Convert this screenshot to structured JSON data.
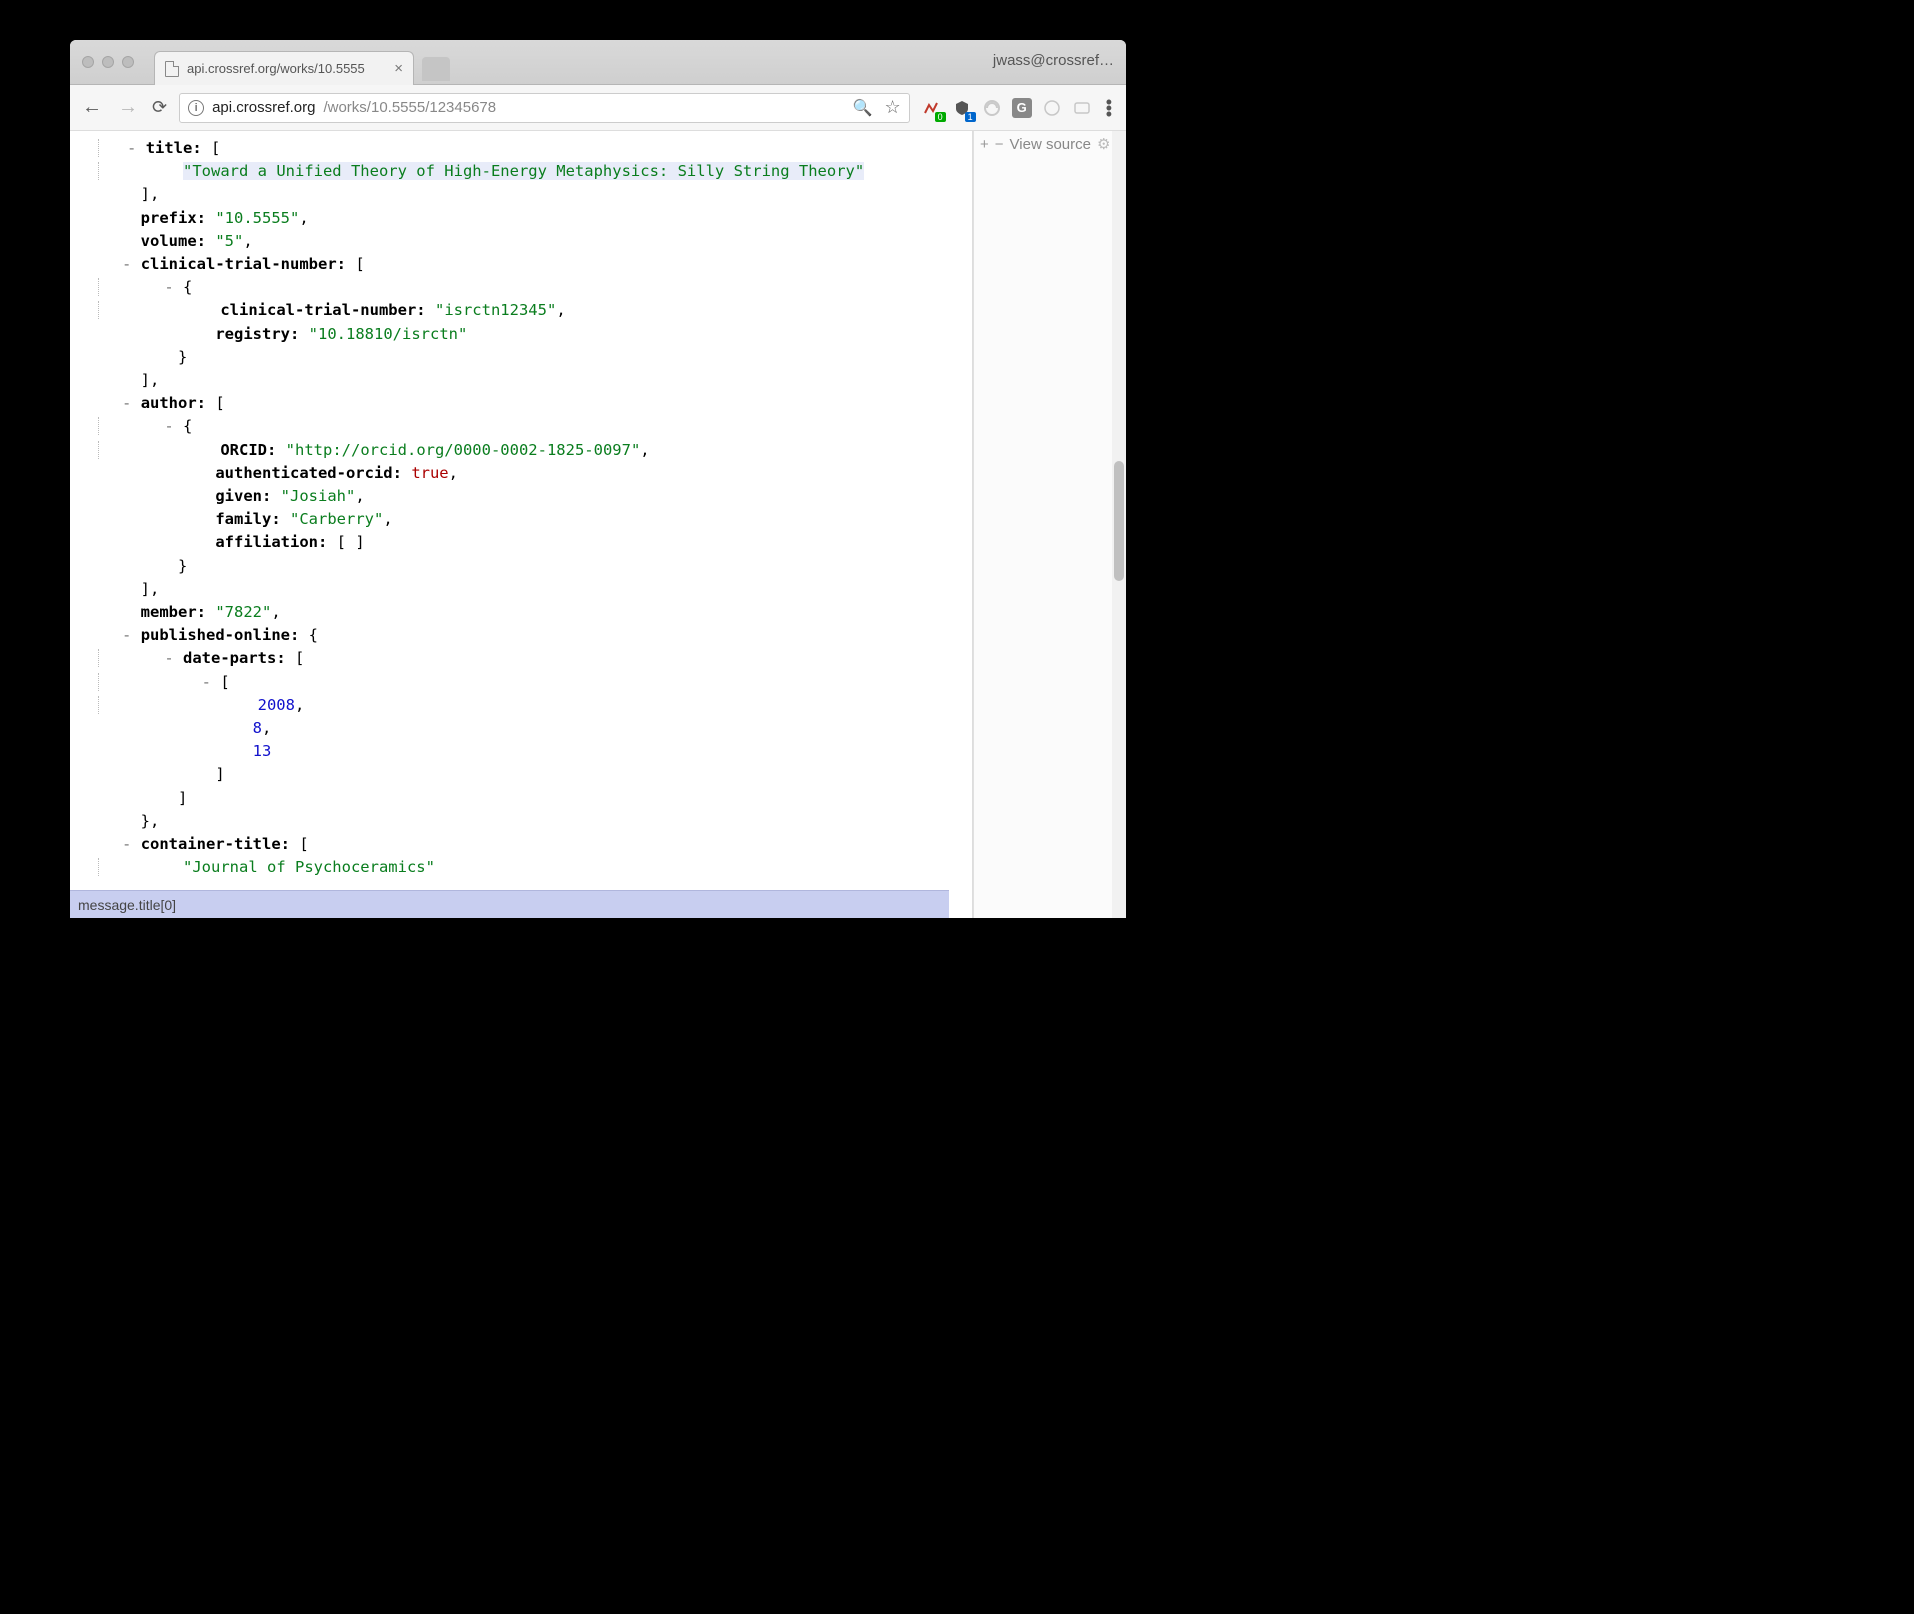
{
  "tab": {
    "title": "api.crossref.org/works/10.5555",
    "close": "×"
  },
  "profile_label": "jwass@crossref…",
  "url": {
    "host": "api.crossref.org",
    "path": "/works/10.5555/12345678"
  },
  "sidebar": {
    "plus": "+",
    "minus": "−",
    "view_source": "View source",
    "gear": "⚙"
  },
  "ext_badges": {
    "green": "0",
    "blue": "1",
    "g": "G"
  },
  "status_path": "message.title[0]",
  "json": {
    "title_key": "title:",
    "title_open": " [",
    "title_value": "\"Toward a Unified Theory of High-Energy Metaphysics: Silly String Theory\"",
    "close_arr": "],",
    "prefix_key": "prefix:",
    "prefix_val": "\"10.5555\"",
    "volume_key": "volume:",
    "volume_val": "\"5\"",
    "ctn_key": "clinical-trial-number:",
    "ctn_open": " [",
    "obj_open": "{",
    "ctn_inner_key": "clinical-trial-number:",
    "ctn_inner_val": "\"isrctn12345\"",
    "registry_key": "registry:",
    "registry_val": "\"10.18810/isrctn\"",
    "obj_close": "}",
    "author_key": "author:",
    "author_open": " [",
    "orcid_key": "ORCID:",
    "orcid_val": "\"http://orcid.org/0000-0002-1825-0097\"",
    "auth_orcid_key": "authenticated-orcid:",
    "auth_orcid_val": "true",
    "given_key": "given:",
    "given_val": "\"Josiah\"",
    "family_key": "family:",
    "family_val": "\"Carberry\"",
    "affil_key": "affiliation:",
    "affil_val": "[ ]",
    "member_key": "member:",
    "member_val": "\"7822\"",
    "pub_key": "published-online:",
    "pub_open": " {",
    "dp_key": "date-parts:",
    "dp_open": " [",
    "arr_open": "[",
    "y": "2008",
    "m": "8",
    "d": "13",
    "arr_close": "]",
    "obj_close_comma": "},",
    "ct_key": "container-title:",
    "ct_open": " [",
    "ct_val": "\"Journal of Psychoceramics\"",
    "dash": "-",
    "comma": ","
  }
}
